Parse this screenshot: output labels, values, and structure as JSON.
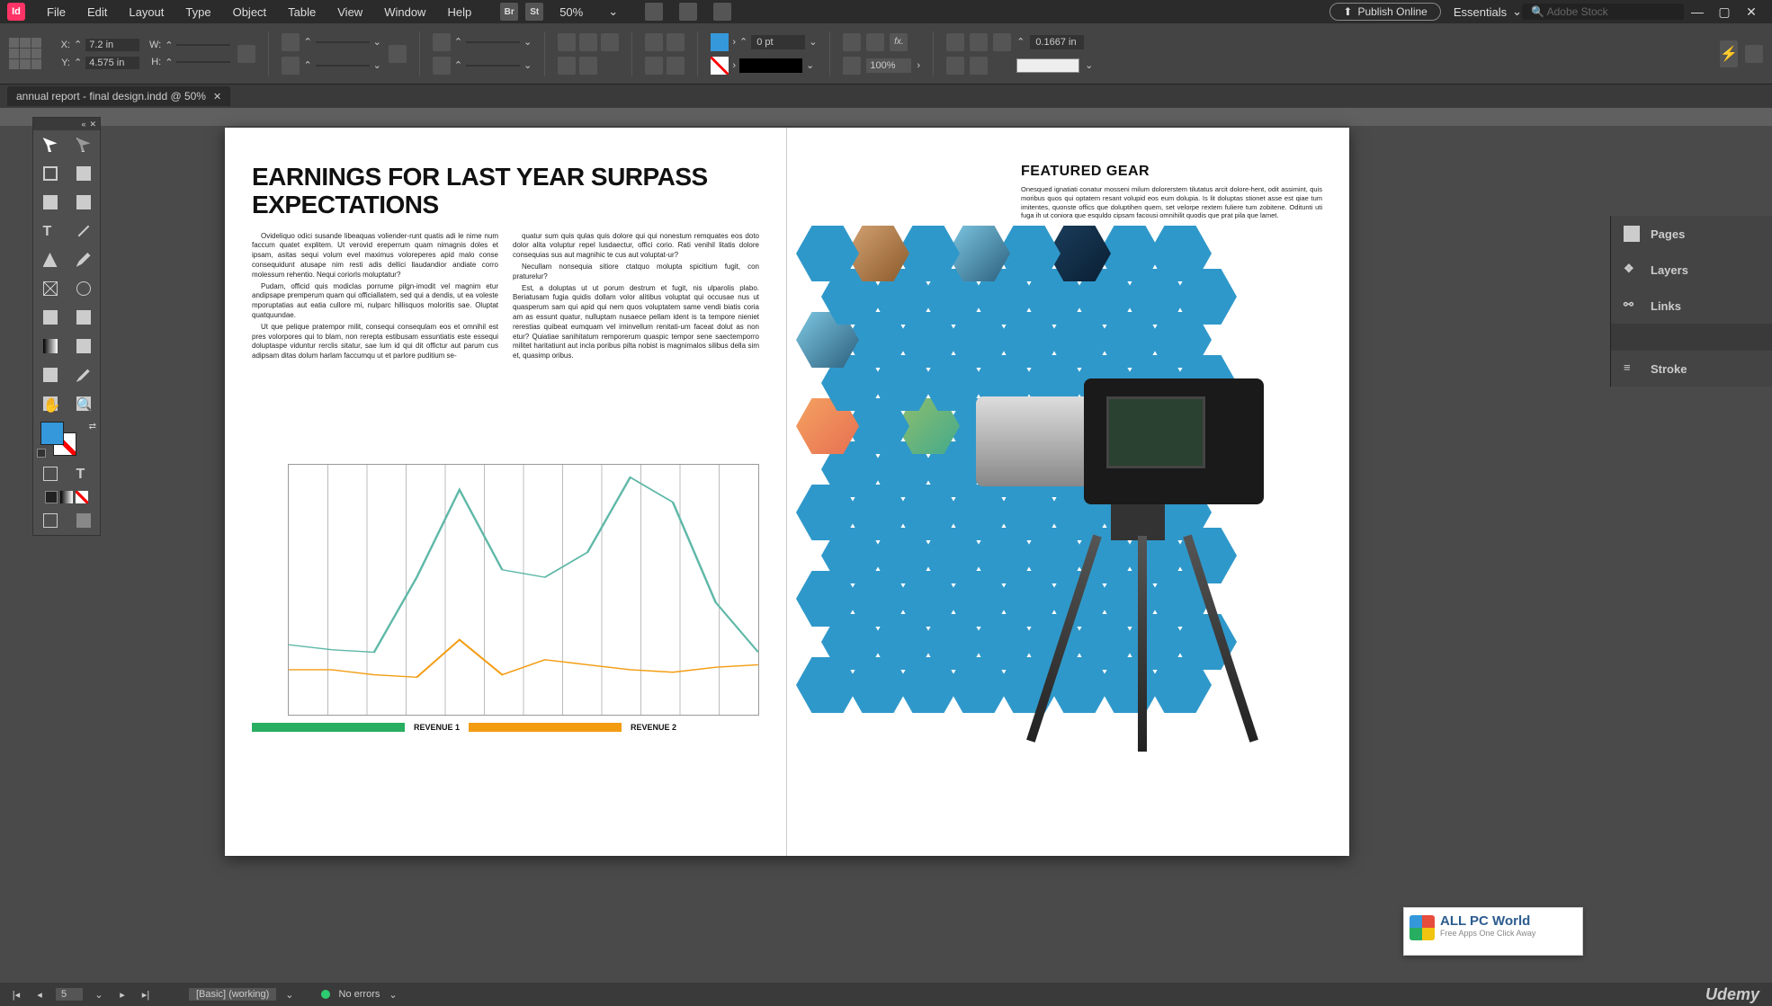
{
  "menu": {
    "items": [
      "File",
      "Edit",
      "Layout",
      "Type",
      "Object",
      "Table",
      "View",
      "Window",
      "Help"
    ]
  },
  "zoom": "50%",
  "publish_label": "Publish Online",
  "workspace_label": "Essentials",
  "stock_placeholder": "Adobe Stock",
  "control": {
    "x_label": "X:",
    "x_val": "7.2 in",
    "y_label": "Y:",
    "y_val": "4.575 in",
    "w_label": "W:",
    "w_val": "",
    "h_label": "H:",
    "h_val": "",
    "stroke_pt": "0 pt",
    "tint": "100%",
    "leading": "0.1667 in"
  },
  "tab_title": "annual report - final design.indd @ 50%",
  "panels": {
    "p1": "Pages",
    "p2": "Layers",
    "p3": "Links",
    "p4": "Stroke"
  },
  "doc": {
    "headline": "EARNINGS FOR LAST YEAR SURPASS EXPECTATIONS",
    "para1": "Ovideliquo odici susande libeaquas voliender-runt quatis adi le nime num faccum quatet explitem. Ut verovid ereperrum quam nimagnis doles et ipsam, asitas sequi volum evel maximus voloreperes apid malo conse consequidunt atusape nim resti adis dellici llaudandior andiate corro molessum rehentio. Nequi coriorls moluptatur?",
    "para2": "Pudam, officid quis modiclas porrume pilgn-imodit vel magnim etur andipsape premperum quam qui officiallatem, sed qui a dendis, ut ea voleste mporuptatias aut eatia cullore mi, nulparc hillisquos moloritis sae. Oluptat quatquundae.",
    "para3": "Ut que pelique pratempor milit, consequi consequlam eos et omnihil est pres volorpores qui to blam, non rerepta estibusam essuntiatis este essequi doluptaspe viduntur rerclis sitatur, sae lum id qui dit offictur aut parum cus adipsam ditas dolum harlam faccumqu ut et parlore puditium se-",
    "para4": "quatur sum quis qulas quis dolore qui qui nonestum remquates eos doto dolor alita voluptur repel lusdaectur, offici corio. Rati venihil litatis dolore consequias sus aut magnihic te cus aut voluptat-ur?",
    "para5": "Necullam nonsequia sitiore ctatquo molupta spicitium fugit, con praturelur?",
    "para6": "Est, a doluptas ut ut porum destrum et fugit, nis ulparolis plabo. Beriatusam fugia quidis dollam volor alitibus voluptat qui occusae nus ut quasperum sam qui apid qui nem quos voluptatem same vendi biatis coria am as essunt quatur, nulluptam nusaece pellam ident is ta tempore nieniet rerestias quibeat eumquam vel iminvellum renitati-um faceat dolut as non etur? Quiatiae sanihitatum remporerum quaspic tempor sene saectemporro militet haritatiunt aut incla poribus pilta nobist is magnimalos silibus della sim et, quasimp oribus.",
    "featured_title": "FEATURED GEAR",
    "featured_text": "Onesqued ignatiati conatur mosseni milum dolorerstem tilutatus arcit dolore-hent, odit assimint, quis moribus quos qui optatem resant volupid eos eum dolupia. Is lit doluptas stionet asse est qiae tum imitentes, quonste offics que doluptihen quem, set velorpe rextem fuliere tum zobitene. Oditunti uti fuga ih ut coniora que esquldo cipsam facousi omnihilit quodis que prat pila que lamet.",
    "legend1": "REVENUE 1",
    "legend2": "REVENUE 2"
  },
  "status": {
    "page": "5",
    "preset": "[Basic] (working)",
    "errors": "No errors"
  },
  "watermark": {
    "line1": "ALL PC World",
    "line2": "Free Apps One Click Away"
  },
  "brand_bottom": "Udemy",
  "chart_data": {
    "type": "line",
    "title": "",
    "series": [
      {
        "name": "REVENUE 1",
        "color": "#5fb8a8",
        "values": [
          28,
          26,
          25,
          55,
          90,
          58,
          55,
          65,
          95,
          85,
          45,
          25
        ]
      },
      {
        "name": "REVENUE 2",
        "color": "#f39c12",
        "values": [
          18,
          18,
          16,
          15,
          30,
          16,
          22,
          20,
          18,
          17,
          19,
          20
        ]
      }
    ],
    "x_ticks": 12,
    "ylim": [
      0,
      100
    ]
  }
}
